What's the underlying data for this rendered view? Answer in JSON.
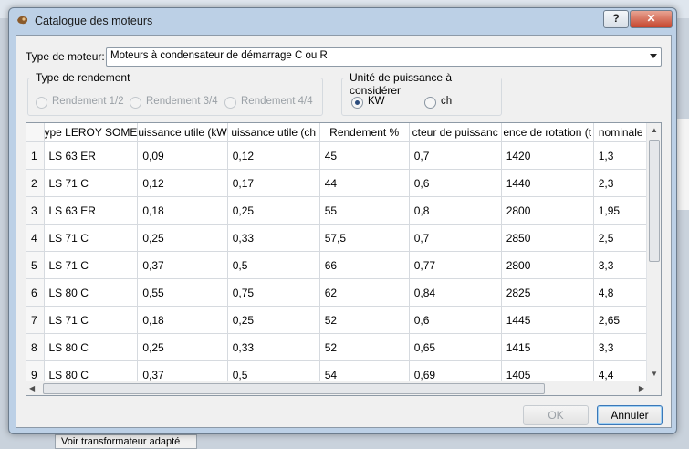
{
  "window": {
    "title": "Catalogue des moteurs",
    "help_label": "?",
    "close_label": "✕"
  },
  "background": {
    "strip_label": "Voir transformateur adapté"
  },
  "motor_type": {
    "label": "Type de moteur:",
    "selected": "Moteurs à condensateur de démarrage C ou R"
  },
  "efficiency_group": {
    "title": "Type de rendement",
    "options": [
      "Rendement 1/2",
      "Rendement 3/4",
      "Rendement 4/4"
    ]
  },
  "power_unit_group": {
    "title": "Unité de puissance à considérer",
    "options": [
      "KW",
      "ch"
    ],
    "selected": "KW"
  },
  "table": {
    "columns": [
      "ype LEROY SOME",
      "uissance utile (kW",
      "uissance utile (ch",
      "Rendement %",
      "cteur de puissanc",
      "ence de rotation (t",
      "nominale"
    ],
    "rows": [
      [
        "1",
        "LS 63 ER",
        "0,09",
        "0,12",
        "45",
        "0,7",
        "1420",
        "1,3"
      ],
      [
        "2",
        "LS 71 C",
        "0,12",
        "0,17",
        "44",
        "0,6",
        "1440",
        "2,3"
      ],
      [
        "3",
        "LS 63 ER",
        "0,18",
        "0,25",
        "55",
        "0,8",
        "2800",
        "1,95"
      ],
      [
        "4",
        "LS 71 C",
        "0,25",
        "0,33",
        "57,5",
        "0,7",
        "2850",
        "2,5"
      ],
      [
        "5",
        "LS 71 C",
        "0,37",
        "0,5",
        "66",
        "0,77",
        "2800",
        "3,3"
      ],
      [
        "6",
        "LS 80 C",
        "0,55",
        "0,75",
        "62",
        "0,84",
        "2825",
        "4,8"
      ],
      [
        "7",
        "LS 71 C",
        "0,18",
        "0,25",
        "52",
        "0,6",
        "1445",
        "2,65"
      ],
      [
        "8",
        "LS 80 C",
        "0,25",
        "0,33",
        "52",
        "0,65",
        "1415",
        "3,3"
      ],
      [
        "9",
        "LS 80 C",
        "0,37",
        "0,5",
        "54",
        "0,69",
        "1405",
        "4,4"
      ]
    ]
  },
  "buttons": {
    "ok": "OK",
    "cancel": "Annuler"
  }
}
